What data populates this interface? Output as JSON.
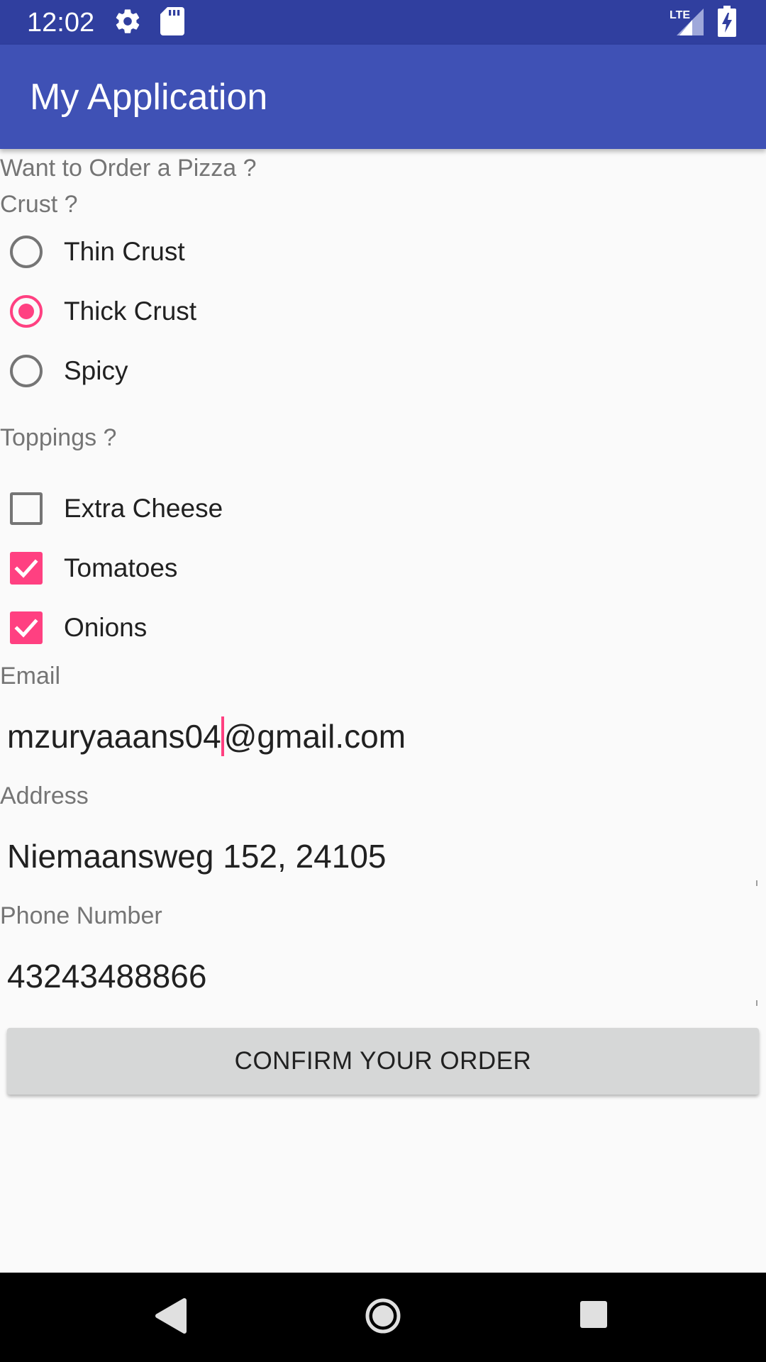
{
  "status_bar": {
    "time": "12:02",
    "icons": [
      "gear-icon",
      "sd-card-icon",
      "lte-signal-icon",
      "battery-charging-icon"
    ],
    "network_label": "LTE"
  },
  "app_bar": {
    "title": "My Application"
  },
  "form": {
    "heading": "Want to Order a Pizza ?",
    "crust_label": "Crust ?",
    "crust_options": [
      {
        "label": "Thin Crust",
        "checked": false
      },
      {
        "label": "Thick Crust",
        "checked": true
      },
      {
        "label": "Spicy",
        "checked": false
      }
    ],
    "toppings_label": "Toppings ?",
    "toppings_options": [
      {
        "label": "Extra Cheese",
        "checked": false
      },
      {
        "label": "Tomatoes",
        "checked": true
      },
      {
        "label": "Onions",
        "checked": true
      }
    ],
    "email_label": "Email",
    "email_value_before_cursor": "mzuryaaans04",
    "email_value_after_cursor": "@gmail.com",
    "address_label": "Address",
    "address_value": "Niemaansweg 152, 24105",
    "phone_label": "Phone Number",
    "phone_value": "43243488866",
    "confirm_button": "CONFIRM YOUR ORDER"
  },
  "nav_bar": {
    "icons": [
      "back-icon",
      "home-icon",
      "recents-icon"
    ]
  },
  "colors": {
    "status_bar": "#303f9f",
    "app_bar": "#3f51b5",
    "accent": "#ff4081",
    "background": "#fafafa",
    "button": "#d6d7d7"
  }
}
